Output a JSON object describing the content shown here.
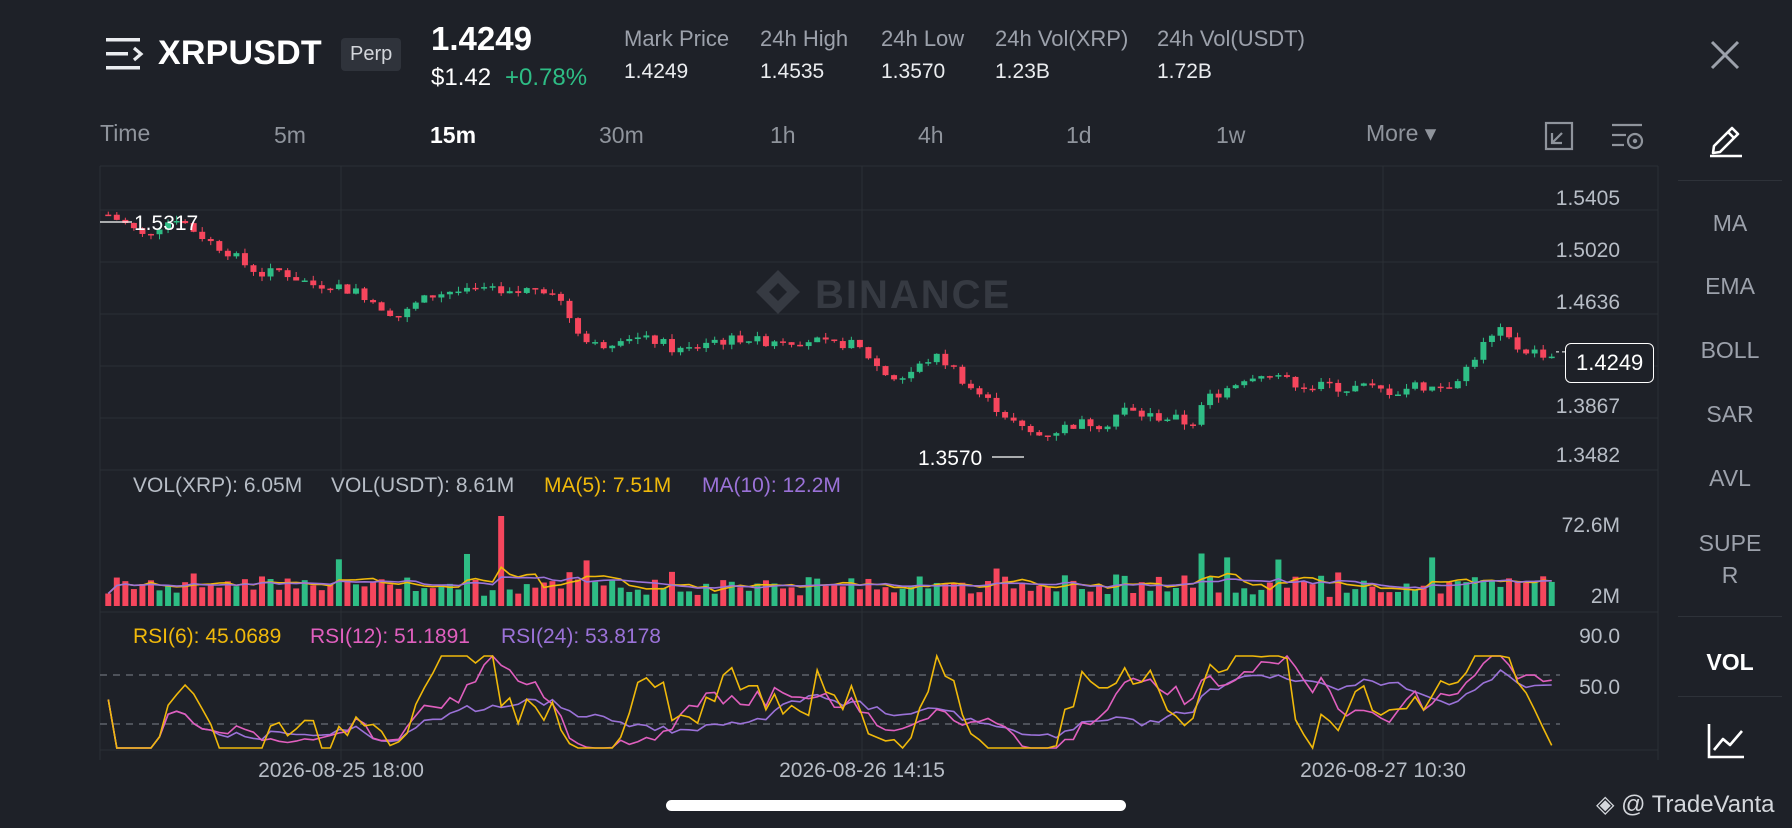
{
  "header": {
    "symbol": "XRPUSDT",
    "contract_type": "Perp",
    "last_price": "1.4249",
    "usd_price": "$1.42",
    "change_pct": "+0.78%",
    "stats": [
      {
        "label": "Mark Price",
        "value": "1.4249"
      },
      {
        "label": "24h High",
        "value": "1.4535"
      },
      {
        "label": "24h Low",
        "value": "1.3570"
      },
      {
        "label": "24h Vol(XRP)",
        "value": "1.23B"
      },
      {
        "label": "24h Vol(USDT)",
        "value": "1.72B"
      }
    ]
  },
  "timeframes": {
    "time_label": "Time",
    "items": [
      "5m",
      "15m",
      "30m",
      "1h",
      "4h",
      "1d",
      "1w"
    ],
    "active": "15m",
    "more_label": "More ▾"
  },
  "sidebar": {
    "indicators": [
      "MA",
      "EMA",
      "BOLL",
      "SAR",
      "AVL",
      "SUPE",
      "R"
    ],
    "vol_label": "VOL"
  },
  "chart_data": {
    "type": "candlestick",
    "watermark": "BINANCE",
    "price_axis_ticks": [
      "1.5405",
      "1.5020",
      "1.4636",
      "1.3867",
      "1.3482"
    ],
    "current_price_tag": "1.4249",
    "high_marker": "1.5317",
    "low_marker": "1.3570",
    "price_path": [
      1.528,
      1.521,
      1.512,
      1.52,
      1.526,
      1.516,
      1.507,
      1.5,
      1.49,
      1.483,
      1.486,
      1.48,
      1.475,
      1.476,
      1.472,
      1.467,
      1.458,
      1.451,
      1.462,
      1.468,
      1.471,
      1.469,
      1.473,
      1.466,
      1.47,
      1.474,
      1.47,
      1.448,
      1.43,
      1.431,
      1.438,
      1.434,
      1.433,
      1.426,
      1.427,
      1.434,
      1.433,
      1.436,
      1.432,
      1.435,
      1.433,
      1.434,
      1.429,
      1.432,
      1.425,
      1.41,
      1.404,
      1.412,
      1.422,
      1.415,
      1.4,
      1.39,
      1.38,
      1.368,
      1.362,
      1.365,
      1.37,
      1.372,
      1.37,
      1.382,
      1.378,
      1.376,
      1.375,
      1.37,
      1.39,
      1.397,
      1.405,
      1.41,
      1.404,
      1.402,
      1.398,
      1.4,
      1.397,
      1.399,
      1.396,
      1.395,
      1.4,
      1.398,
      1.4,
      1.412,
      1.43,
      1.44,
      1.428,
      1.425,
      1.422
    ],
    "volume_axis_ticks": [
      "72.6M",
      "2M"
    ],
    "volume_legend": {
      "vol_xrp": "VOL(XRP): 6.05M",
      "vol_usdt": "VOL(USDT): 8.61M",
      "ma5": "MA(5): 7.51M",
      "ma10": "MA(10): 12.2M"
    },
    "rsi_axis_ticks": [
      "90.0",
      "50.0"
    ],
    "rsi_legend": {
      "rsi6": "RSI(6): 45.0689",
      "rsi12": "RSI(12): 51.1891",
      "rsi24": "RSI(24): 53.8178"
    },
    "time_axis_labels": [
      "2026-08-25 18:00",
      "2026-08-26 14:15",
      "2026-08-27 10:30"
    ]
  },
  "colors": {
    "up": "#2ebd85",
    "down": "#f6465d",
    "ma5": "#f0b90b",
    "ma10": "#9b72d8",
    "rsi12": "#e05fbe"
  },
  "footer": {
    "brand": "@ TradeVanta"
  }
}
